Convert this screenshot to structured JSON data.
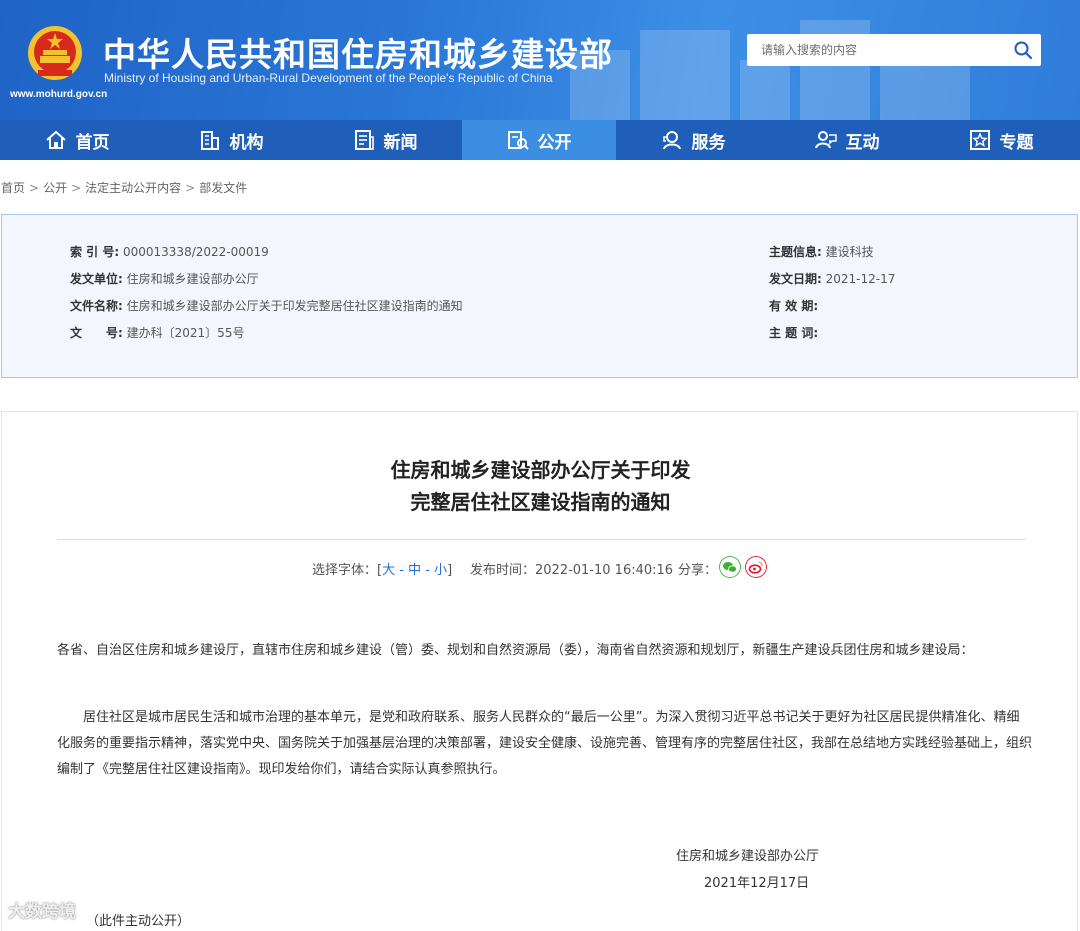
{
  "header": {
    "title": "中华人民共和国住房和城乡建设部",
    "subtitle": "Ministry of Housing and Urban-Rural Development of the People's Republic of China",
    "url": "www.mohurd.gov.cn",
    "search_placeholder": "请输入搜索的内容"
  },
  "nav": {
    "items": [
      {
        "label": "首页",
        "icon": "home-icon"
      },
      {
        "label": "机构",
        "icon": "building-icon"
      },
      {
        "label": "新闻",
        "icon": "news-icon"
      },
      {
        "label": "公开",
        "icon": "open-icon"
      },
      {
        "label": "服务",
        "icon": "service-icon"
      },
      {
        "label": "互动",
        "icon": "interact-icon"
      },
      {
        "label": "专题",
        "icon": "star-icon"
      }
    ],
    "active_index": 3
  },
  "breadcrumb": [
    "首页",
    "公开",
    "法定主动公开内容",
    "部发文件"
  ],
  "info": {
    "index_label": "索 引 号:",
    "index_value": "000013338/2022-00019",
    "topic_label": "主题信息:",
    "topic_value": "建设科技",
    "issuer_label": "发文单位:",
    "issuer_value": "住房和城乡建设部办公厅",
    "date_label": "发文日期:",
    "date_value": "2021-12-17",
    "filename_label": "文件名称:",
    "filename_value": "住房和城乡建设部办公厅关于印发完整居住社区建设指南的通知",
    "validity_label": "有 效 期:",
    "validity_value": "",
    "docno_label": "文　　号:",
    "docno_value": "建办科〔2021〕55号",
    "subject_label": "主 题 词:",
    "subject_value": ""
  },
  "article": {
    "title_line1": "住房和城乡建设部办公厅关于印发",
    "title_line2": "完整居住社区建设指南的通知",
    "font_select_label": "选择字体：[",
    "font_large": "大",
    "font_medium": "中",
    "font_small": "小",
    "font_sep": " - ",
    "font_close": "]",
    "publish_time": "发布时间：2022-01-10 16:40:16",
    "share_label": "分享：",
    "para1": "各省、自治区住房和城乡建设厅，直辖市住房和城乡建设（管）委、规划和自然资源局（委），海南省自然资源和规划厅，新疆生产建设兵团住房和城乡建设局：",
    "para2": "居住社区是城市居民生活和城市治理的基本单元，是党和政府联系、服务人民群众的“最后一公里”。为深入贯彻习近平总书记关于更好为社区居民提供精准化、精细化服务的重要指示精神，落实党中央、国务院关于加强基层治理的决策部署，建设安全健康、设施完善、管理有序的完整居住社区，我部在总结地方实践经验基础上，组织编制了《完整居住社区建设指南》。现印发给你们，请结合实际认真参照执行。",
    "signer": "住房和城乡建设部办公厅",
    "sign_date": "2021年12月17日",
    "public_note": "（此件主动公开）"
  },
  "watermark": "大数跨境",
  "colors": {
    "header_blue": "#2a78d8",
    "nav_blue": "#1f5fb9",
    "nav_active": "#3c8ee3",
    "info_bg": "#f3f7fd",
    "link_blue": "#1e6fd6"
  }
}
